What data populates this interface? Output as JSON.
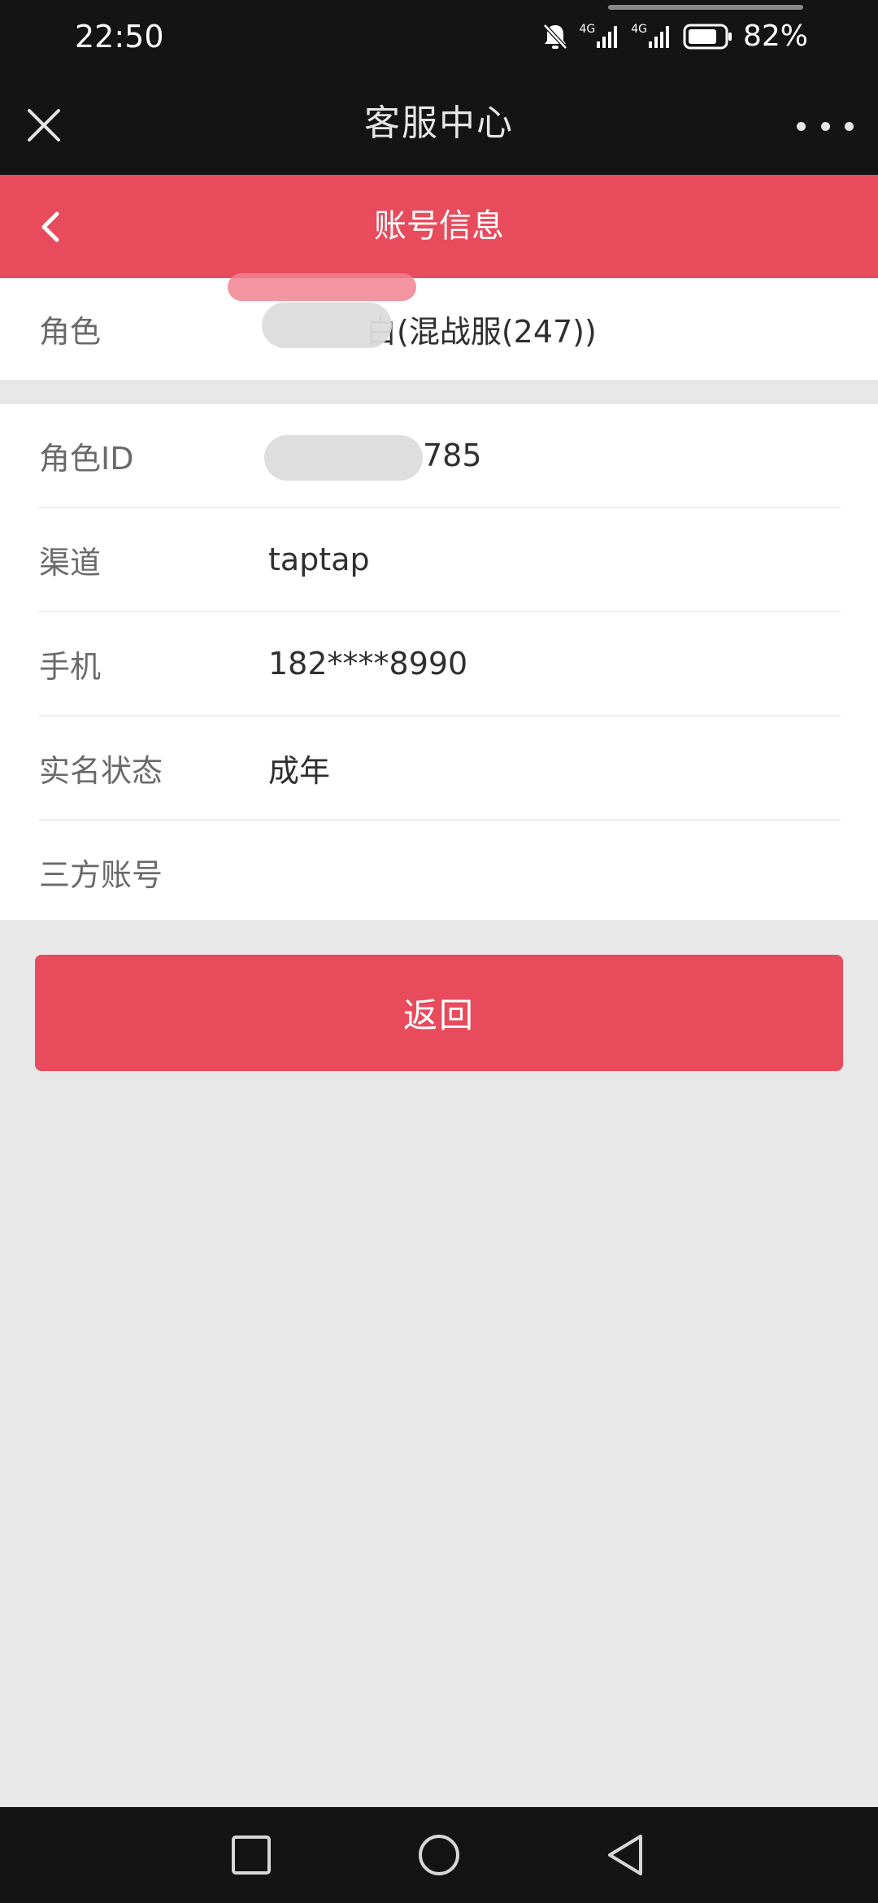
{
  "status_bar": {
    "time": "22:50",
    "battery_percent": "82%",
    "signal_1_label": "4G",
    "signal_2_label": "4G",
    "battery_level": 0.82
  },
  "title_bar": {
    "title": "客服中心"
  },
  "page_header": {
    "title": "账号信息"
  },
  "role_row": {
    "label": "角色",
    "value": "白(混战服(247))"
  },
  "details": [
    {
      "label": "角色ID",
      "value": "785"
    },
    {
      "label": "渠道",
      "value": "taptap"
    },
    {
      "label": "手机",
      "value": "182****8990"
    },
    {
      "label": "实名状态",
      "value": "成年"
    },
    {
      "label": "三方账号",
      "value": ""
    }
  ],
  "actions": {
    "return_label": "返回"
  },
  "colors": {
    "accent": "#e84b5c",
    "bar_dark": "#141414",
    "background": "#e8e8e8"
  }
}
